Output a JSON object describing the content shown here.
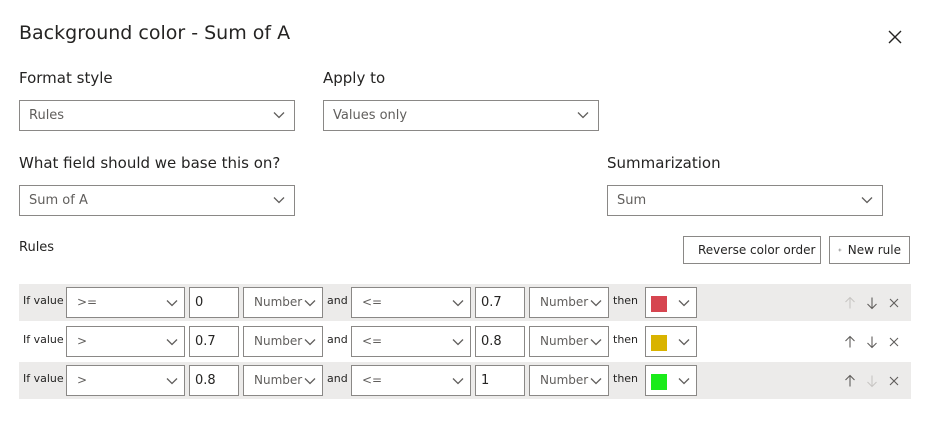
{
  "dialog": {
    "title": "Background color - Sum of A"
  },
  "format_style": {
    "label": "Format style",
    "value": "Rules"
  },
  "apply_to": {
    "label": "Apply to",
    "value": "Values only"
  },
  "base_field": {
    "label": "What field should we base this on?",
    "value": "Sum of A"
  },
  "summarization": {
    "label": "Summarization",
    "value": "Sum"
  },
  "rules_section": {
    "label": "Rules",
    "reverse_label": "Reverse color order",
    "new_rule_label": "New rule"
  },
  "rules": [
    {
      "if_label": "If value",
      "op1": ">=",
      "val1": "0",
      "type1": "Number",
      "and_label": "and",
      "op2": "<=",
      "val2": "0.7",
      "type2": "Number",
      "then_label": "then",
      "color": "#d64550"
    },
    {
      "if_label": "If value",
      "op1": ">",
      "val1": "0.7",
      "type1": "Number",
      "and_label": "and",
      "op2": "<=",
      "val2": "0.8",
      "type2": "Number",
      "then_label": "then",
      "color": "#d9b300"
    },
    {
      "if_label": "If value",
      "op1": ">",
      "val1": "0.8",
      "type1": "Number",
      "and_label": "and",
      "op2": "<=",
      "val2": "1",
      "type2": "Number",
      "then_label": "then",
      "color": "#1aeb1a"
    }
  ],
  "icons": {
    "close": "close-icon",
    "chevron": "chevron-down-icon",
    "reverse": "sort-icon",
    "add": "plus-icon",
    "up": "arrow-up-icon",
    "down": "arrow-down-icon",
    "delete": "close-icon"
  }
}
